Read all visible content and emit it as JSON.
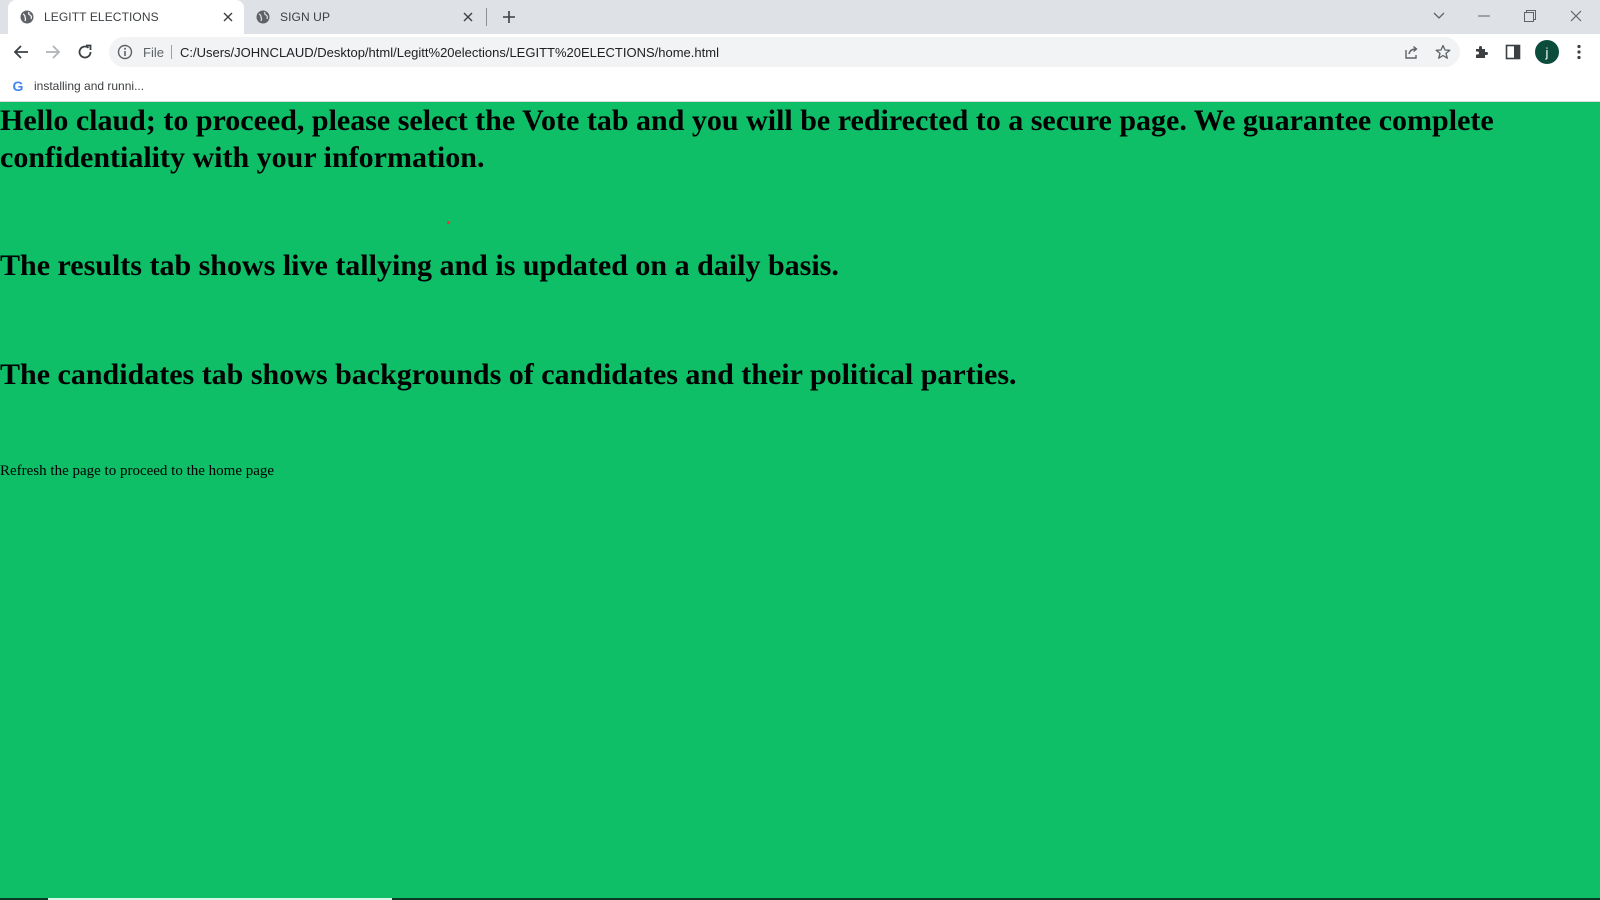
{
  "browser": {
    "tabs": [
      {
        "title": "LEGITT ELECTIONS",
        "active": true
      },
      {
        "title": "SIGN UP",
        "active": false
      }
    ],
    "address_bar": {
      "scheme_label": "File",
      "url": "C:/Users/JOHNCLAUD/Desktop/html/Legitt%20elections/LEGITT%20ELECTIONS/home.html"
    },
    "profile_initial": "j",
    "bookmarks": [
      {
        "label": "installing and runni...",
        "icon": "google-icon"
      }
    ]
  },
  "page": {
    "background_color": "#0ebf68",
    "heading1": "Hello claud; to proceed, please select the Vote tab and you will be redirected to a secure page. We guarantee complete confidentiality with your information.",
    "heading2": "The results tab shows live tallying and is updated on a daily basis.",
    "heading3": "The candidates tab shows backgrounds of candidates and their political parties.",
    "footer_note": "Refresh the page to proceed to the home page"
  }
}
